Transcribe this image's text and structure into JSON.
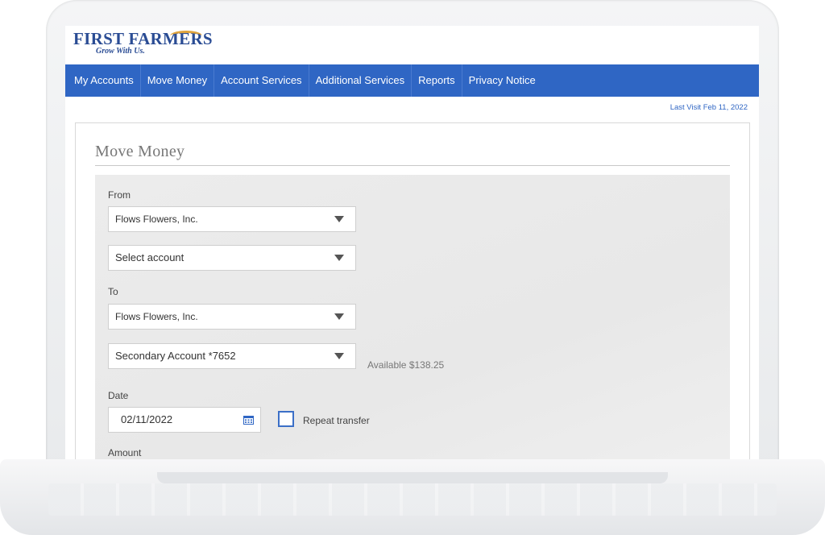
{
  "brand": {
    "name": "FIRST FARMERS",
    "tagline": "Grow With Us.",
    "primary_color": "#2f66c4"
  },
  "nav": {
    "items": [
      {
        "label": "My Accounts"
      },
      {
        "label": "Move Money"
      },
      {
        "label": "Account Services"
      },
      {
        "label": "Additional Services"
      },
      {
        "label": "Reports"
      },
      {
        "label": "Privacy Notice"
      }
    ]
  },
  "last_visit": "Last Visit Feb 11, 2022",
  "page": {
    "title": "Move Money"
  },
  "form": {
    "from_label": "From",
    "from_entity": "Flows Flowers, Inc.",
    "from_account": "Select account",
    "to_label": "To",
    "to_entity": "Flows Flowers, Inc.",
    "to_account": "Secondary Account *7652",
    "available": "Available $138.25",
    "date_label": "Date",
    "date_value": "02/11/2022",
    "repeat_label": "Repeat transfer",
    "amount_label": "Amount",
    "calendar_icon": "calendar-icon",
    "caret_icon": "chevron-down-icon"
  }
}
